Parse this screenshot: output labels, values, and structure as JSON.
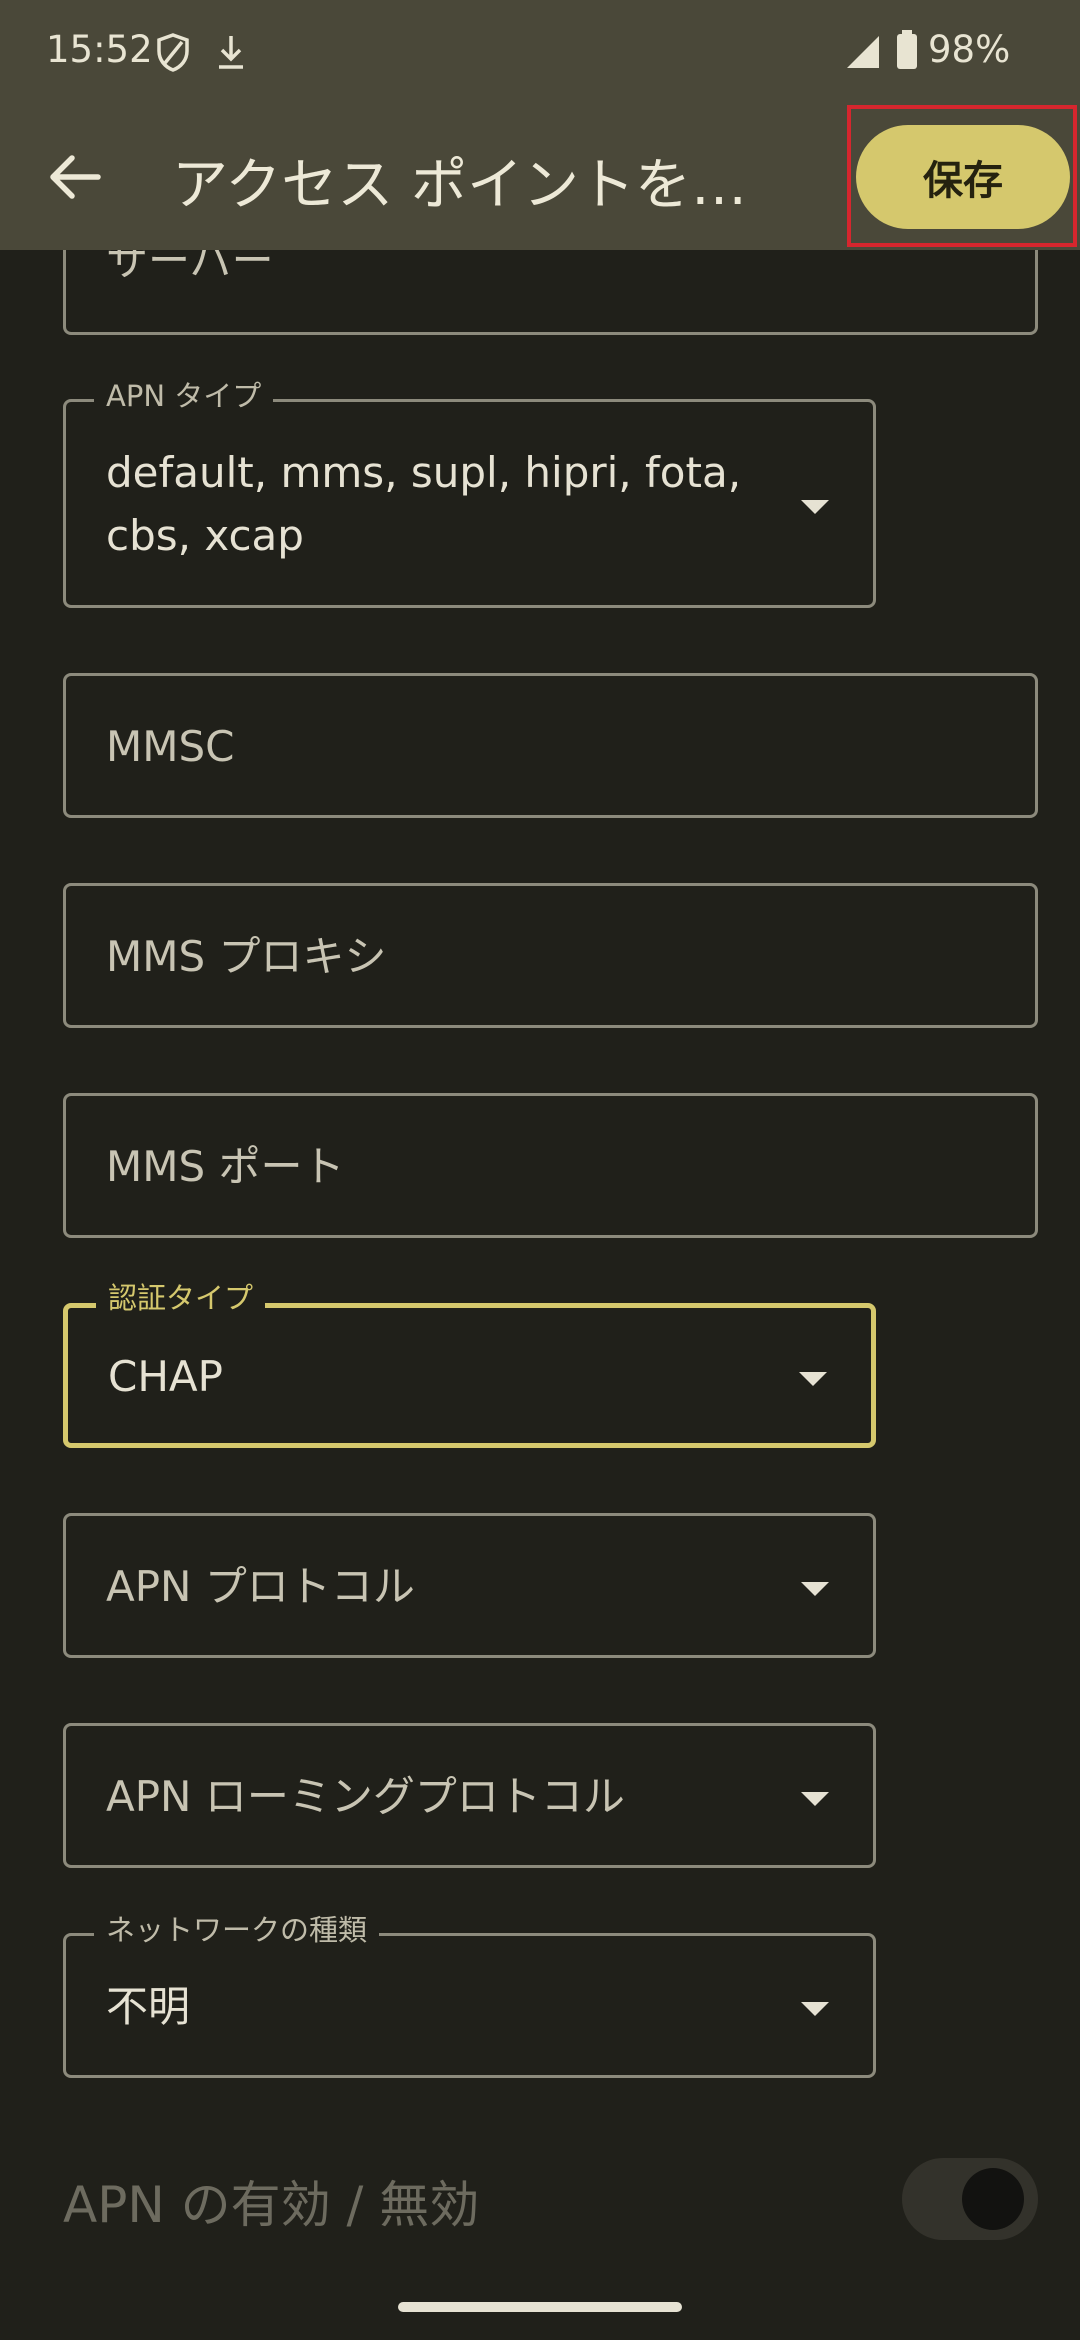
{
  "status_bar": {
    "time": "15:52",
    "battery": "98%",
    "icons": [
      "shield-icon",
      "download-icon",
      "signal-icon",
      "battery-icon"
    ]
  },
  "app_bar": {
    "title": "アクセス ポイントを…",
    "save_label": "保存",
    "back_icon": "arrow-back-icon"
  },
  "fields": {
    "server": {
      "value": "サーバー"
    },
    "apn_type": {
      "legend": "APN タイプ",
      "value_line1": "default, mms, supl, hipri, fota,",
      "value_line2": "cbs, xcap"
    },
    "mmsc": {
      "placeholder": "MMSC"
    },
    "mms_proxy": {
      "placeholder": "MMS プロキシ"
    },
    "mms_port": {
      "placeholder": "MMS ポート"
    },
    "auth_type": {
      "legend": "認証タイプ",
      "value": "CHAP"
    },
    "apn_protocol": {
      "placeholder": "APN プロトコル"
    },
    "apn_roaming_protocol": {
      "placeholder": "APN ローミングプロトコル"
    },
    "network_type": {
      "legend": "ネットワークの種類",
      "value": "不明"
    }
  },
  "apn_toggle": {
    "label": "APN の有効 / 無効",
    "state": "off"
  },
  "colors": {
    "background": "#20201a",
    "app_bar": "#4a4839",
    "accent": "#d5c86d",
    "highlight": "#d6262e"
  }
}
